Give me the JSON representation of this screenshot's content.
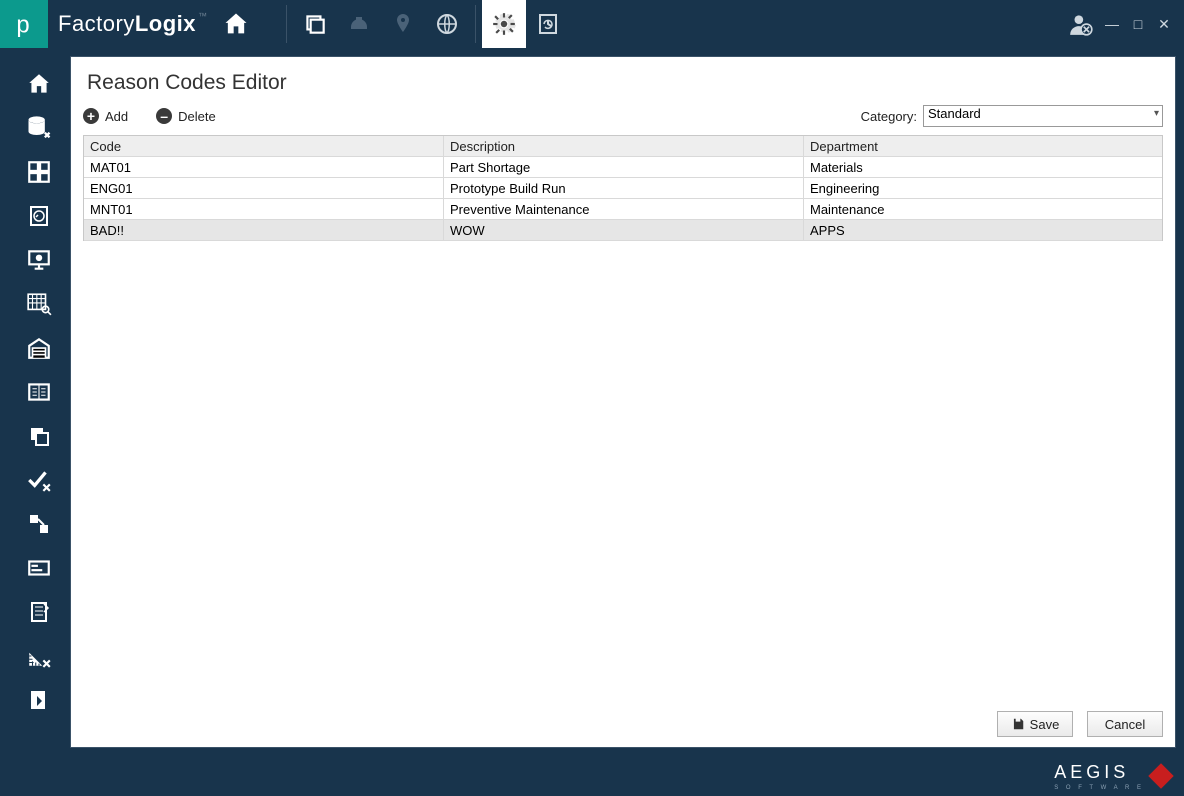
{
  "brand": {
    "part1": "Factory",
    "part2": "Logix"
  },
  "page_title": "Reason Codes Editor",
  "actions": {
    "add": "Add",
    "delete": "Delete"
  },
  "category": {
    "label": "Category:",
    "value": "Standard"
  },
  "table": {
    "headers": {
      "code": "Code",
      "description": "Description",
      "department": "Department"
    },
    "rows": [
      {
        "code": "MAT01",
        "description": "Part Shortage",
        "department": "Materials",
        "selected": false
      },
      {
        "code": "ENG01",
        "description": "Prototype Build Run",
        "department": "Engineering",
        "selected": false
      },
      {
        "code": "MNT01",
        "description": "Preventive Maintenance",
        "department": "Maintenance",
        "selected": false
      },
      {
        "code": "BAD!!",
        "description": "WOW",
        "department": "APPS",
        "selected": true
      }
    ]
  },
  "buttons": {
    "save": "Save",
    "cancel": "Cancel"
  },
  "footer": {
    "brand": "AEGIS",
    "sub": "S O F T W A R E"
  }
}
